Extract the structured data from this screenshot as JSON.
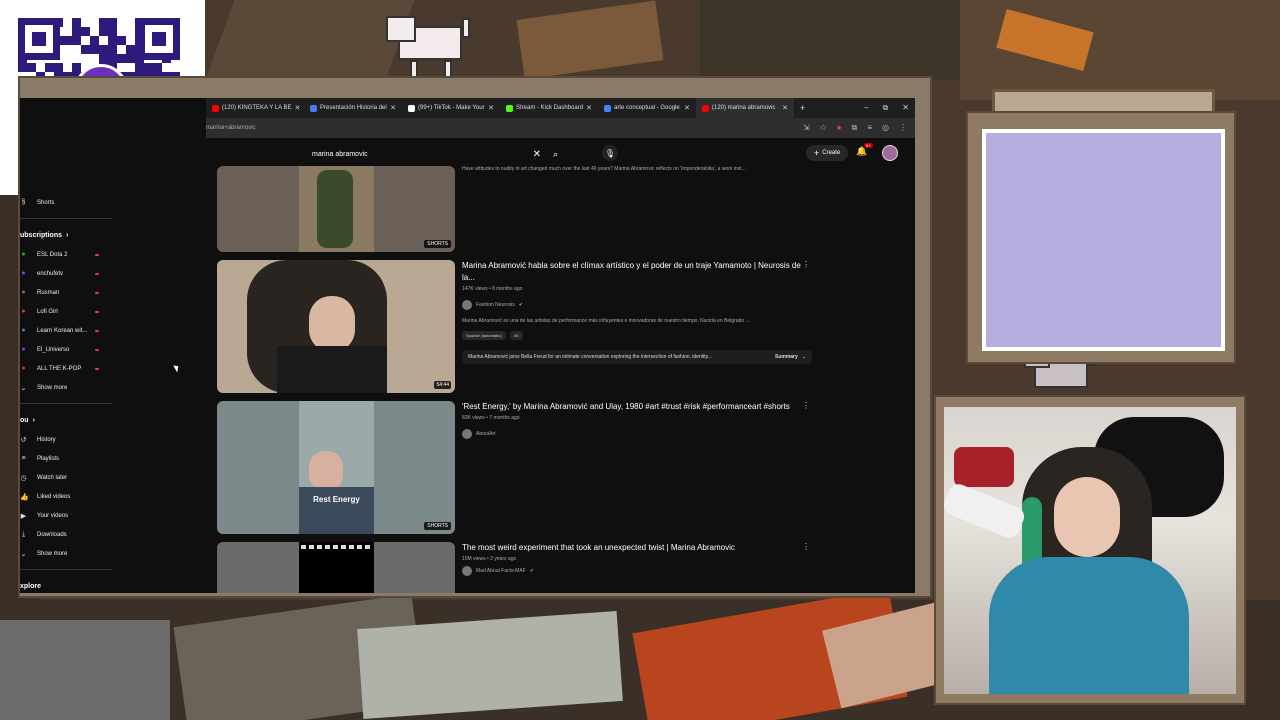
{
  "overlay": {
    "qr_brand": "yape"
  },
  "browser": {
    "tabs": [
      {
        "label": "(120) KINGTEKA Y LA BE",
        "color": "#ff0000"
      },
      {
        "label": "Presentación Historia del",
        "color": "#4a7af0"
      },
      {
        "label": "(99+) TikTok - Make Your",
        "color": "#ffffff"
      },
      {
        "label": "Stream - Kick Dashboard",
        "color": "#53fc18"
      },
      {
        "label": "arte conceptual - Google",
        "color": "#4285f4"
      },
      {
        "label": "(120) marina abramovic",
        "color": "#ff0000",
        "active": true
      }
    ],
    "new_tab": "+",
    "address": "marina+abramovic",
    "window_controls": [
      "–",
      "⧉",
      "✕"
    ]
  },
  "youtube": {
    "search_query": "marina abramovic",
    "create_label": "Create",
    "notif_count": "9+",
    "sidebar": {
      "shorts": "Shorts",
      "subscriptions_heading": "ubscriptions",
      "subscriptions": [
        {
          "label": "ESL Dota 2",
          "icon_color": "#2aa12a"
        },
        {
          "label": "enchufetv",
          "icon_color": "#3a6ad0"
        },
        {
          "label": "Rusman",
          "icon_color": "#8a6a4a"
        },
        {
          "label": "Lofi Girl",
          "icon_color": "#c04060"
        },
        {
          "label": "Learn Korean wit...",
          "icon_color": "#4a7ad0"
        },
        {
          "label": "El_Universo",
          "icon_color": "#6a4ad0"
        },
        {
          "label": "ALL THE K-POP",
          "icon_color": "#d02a4a"
        }
      ],
      "show_more_1": "Show more",
      "you_heading": "ou",
      "you_items": [
        "History",
        "Playlists",
        "Watch later",
        "Liked videos",
        "Your videos",
        "Downloads"
      ],
      "show_more_2": "Show more",
      "explore_heading": "xplore"
    },
    "videos": [
      {
        "title": "",
        "description": "Have attitudes to nudity in art changed much over the last 40 years? Marina Abramovic reflects on 'Imponderabilia', a work inst...",
        "badge": "SHORTS"
      },
      {
        "title": "Marina Abramović habla sobre el clímax artístico y el poder de un traje Yamamoto | Neurosis de la...",
        "stats": "147K views • 8 months ago",
        "channel": "Fashion Neurosis",
        "description": "Marina Abramović es una de las artistas de performance más influyentes e innovadoras de nuestro tiempo. Nacida en Belgrado ...",
        "chips": [
          "Spanish (automatic)",
          "4K"
        ],
        "summary": "Marina Abramović joins Bella Freud for an intimate conversation exploring the intersection of fashion, identity...",
        "summary_label": "Summary",
        "duration": "54:44"
      },
      {
        "title": "'Rest Energy,' by Marina Abramović and Ulay, 1980 #art #trust #risk #performanceart #shorts",
        "stats": "83K views • 7 months ago",
        "channel": "AboutArt",
        "thumb_caption": "Rest Energy",
        "badge": "SHORTS"
      },
      {
        "title": "The most weird experiment that took an unexpected twist | Marina Abramovic",
        "stats": "10M views • 2 years ago",
        "channel": "Mad About Facts-MAF"
      }
    ]
  }
}
